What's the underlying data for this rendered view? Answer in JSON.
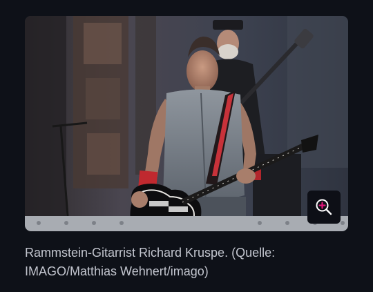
{
  "image": {
    "alt": "Rammstein-Gitarrist Richard Kruspe",
    "zoom_icon": "zoom-in-icon",
    "zoom_accent": "#e0157a"
  },
  "caption": {
    "text": "Rammstein-Gitarrist Richard Kruspe. (Quelle: IMAGO/Matthias Wehnert/imago)"
  },
  "colors": {
    "page_background": "#0e1118",
    "caption_text": "#c3c6cf",
    "zoom_button_background": "#0d0f16"
  }
}
